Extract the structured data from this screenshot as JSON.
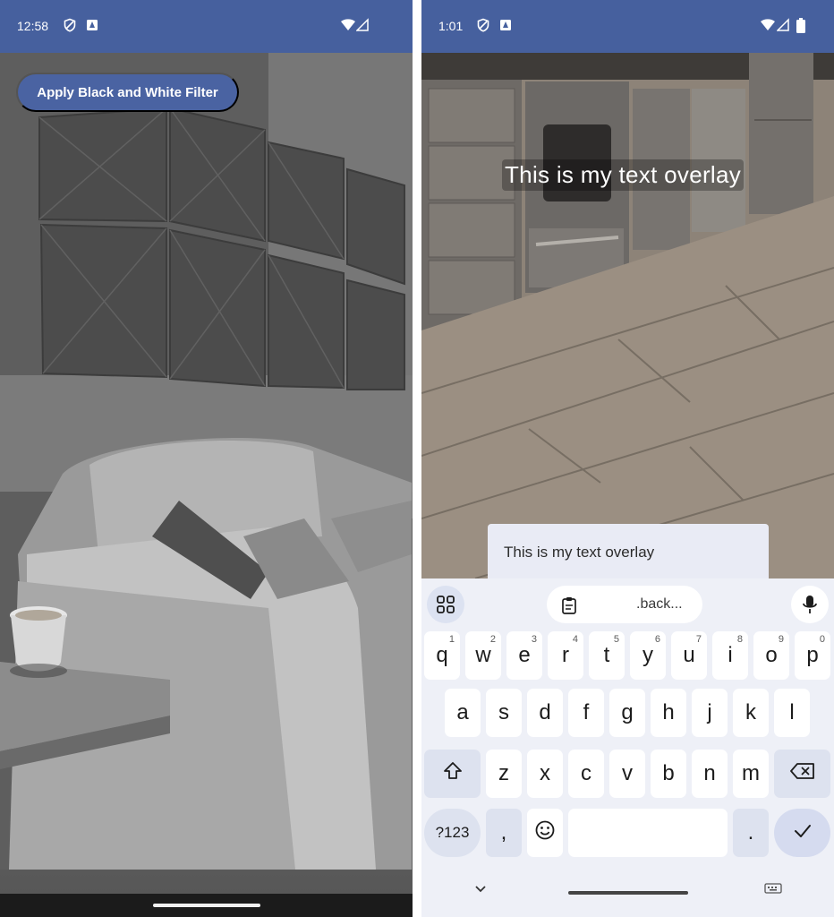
{
  "left_screen": {
    "status": {
      "time": "12:58"
    },
    "filter_button": {
      "label": "Apply Black and White Filter"
    }
  },
  "right_screen": {
    "status": {
      "time": "1:01"
    },
    "overlay_text": "This is my text overlay",
    "text_field": {
      "value": "This is my text overlay"
    },
    "keyboard": {
      "suggestion": ".back...",
      "row1": [
        {
          "key": "q",
          "hint": "1"
        },
        {
          "key": "w",
          "hint": "2"
        },
        {
          "key": "e",
          "hint": "3"
        },
        {
          "key": "r",
          "hint": "4"
        },
        {
          "key": "t",
          "hint": "5"
        },
        {
          "key": "y",
          "hint": "6"
        },
        {
          "key": "u",
          "hint": "7"
        },
        {
          "key": "i",
          "hint": "8"
        },
        {
          "key": "o",
          "hint": "9"
        },
        {
          "key": "p",
          "hint": "0"
        }
      ],
      "row2": [
        "a",
        "s",
        "d",
        "f",
        "g",
        "h",
        "j",
        "k",
        "l"
      ],
      "row3": [
        "z",
        "x",
        "c",
        "v",
        "b",
        "n",
        "m"
      ],
      "symbols_key": "?123",
      "comma_key": ",",
      "period_key": "."
    }
  },
  "colors": {
    "status_bar": "#46609e",
    "filter_button": "#4a63a2",
    "keyboard_background": "#eef0f7",
    "enter_key": "#d5dbef"
  },
  "icons": [
    "do-not-disturb-icon",
    "notification-icon",
    "wifi-icon",
    "signal-icon",
    "battery-icon",
    "apps-grid-icon",
    "clipboard-icon",
    "microphone-icon",
    "shift-icon",
    "backspace-icon",
    "emoji-icon",
    "enter-check-icon",
    "hide-keyboard-chevron-icon",
    "keyboard-switch-icon"
  ]
}
